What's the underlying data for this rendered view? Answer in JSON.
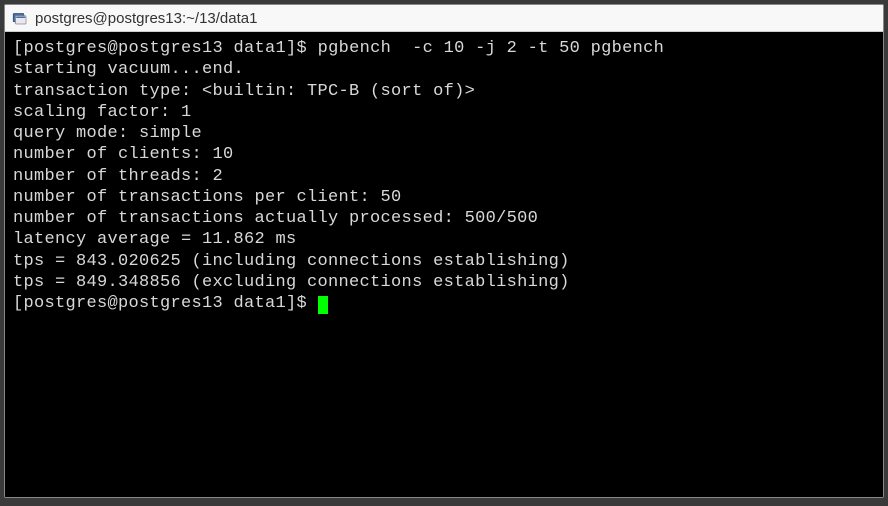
{
  "window": {
    "title": "postgres@postgres13:~/13/data1"
  },
  "terminal": {
    "prompt": "[postgres@postgres13 data1]$",
    "command": "pgbench  -c 10 -j 2 -t 50 pgbench",
    "lines": {
      "l0": "starting vacuum...end.",
      "l1": "transaction type: <builtin: TPC-B (sort of)>",
      "l2": "scaling factor: 1",
      "l3": "query mode: simple",
      "l4": "number of clients: 10",
      "l5": "number of threads: 2",
      "l6": "number of transactions per client: 50",
      "l7": "number of transactions actually processed: 500/500",
      "l8": "latency average = 11.862 ms",
      "l9": "tps = 843.020625 (including connections establishing)",
      "l10": "tps = 849.348856 (excluding connections establishing)"
    }
  }
}
